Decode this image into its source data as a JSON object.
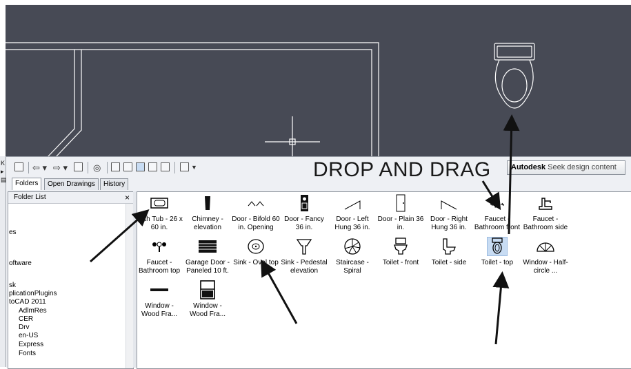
{
  "toolbar": {
    "overlay_text": "DROP AND DRAG",
    "seek_brand": "Autodesk",
    "seek_rest": " Seek design content"
  },
  "tabs": [
    "Folders",
    "Open Drawings",
    "History"
  ],
  "folder_pane": {
    "title": "Folder List",
    "close": "×",
    "items": [
      "es",
      "oftware",
      "sk",
      "plicationPlugins",
      "toCAD 2011",
      "AdlmRes",
      "CER",
      "Drv",
      "en-US",
      "Express",
      "Fonts"
    ]
  },
  "left_strip": [
    "K",
    "▸",
    "▤"
  ],
  "content_items": [
    {
      "label": "Bath Tub - 26 x 60 in.",
      "icon": "bathtub-icon"
    },
    {
      "label": "Chimney - elevation",
      "icon": "chimney-icon"
    },
    {
      "label": "Door - Bifold 60 in. Opening",
      "icon": "door-bifold-icon"
    },
    {
      "label": "Door - Fancy 36 in.",
      "icon": "door-fancy-icon"
    },
    {
      "label": "Door - Left Hung 36 in.",
      "icon": "door-left-icon"
    },
    {
      "label": "Door - Plain 36 in.",
      "icon": "door-plain-icon"
    },
    {
      "label": "Door - Right Hung 36 in.",
      "icon": "door-right-icon"
    },
    {
      "label": "Faucet - Bathroom front",
      "icon": "faucet-front-icon"
    },
    {
      "label": "Faucet - Bathroom side",
      "icon": "faucet-side-icon"
    },
    {
      "label": "Faucet - Bathroom top",
      "icon": "faucet-top-icon"
    },
    {
      "label": "Garage Door - Paneled 10 ft.",
      "icon": "garage-door-icon"
    },
    {
      "label": "Sink - Oval top",
      "icon": "sink-oval-icon"
    },
    {
      "label": "Sink - Pedestal elevation",
      "icon": "sink-pedestal-icon"
    },
    {
      "label": "Staircase - Spiral",
      "icon": "staircase-spiral-icon"
    },
    {
      "label": "Toilet - front",
      "icon": "toilet-front-icon"
    },
    {
      "label": "Toilet - side",
      "icon": "toilet-side-icon"
    },
    {
      "label": "Toilet - top",
      "icon": "toilet-top-icon",
      "selected": true
    },
    {
      "label": "Window - Half-circle ...",
      "icon": "window-halfcircle-icon"
    },
    {
      "label": "Window - Wood Fra...",
      "icon": "window-wood-icon"
    },
    {
      "label": "Window - Wood Fra...",
      "icon": "window-wood2-icon"
    }
  ],
  "colors": {
    "cad_background": "#474a55",
    "cad_lines": "#ffffff",
    "selection": "#c8dcf3"
  }
}
